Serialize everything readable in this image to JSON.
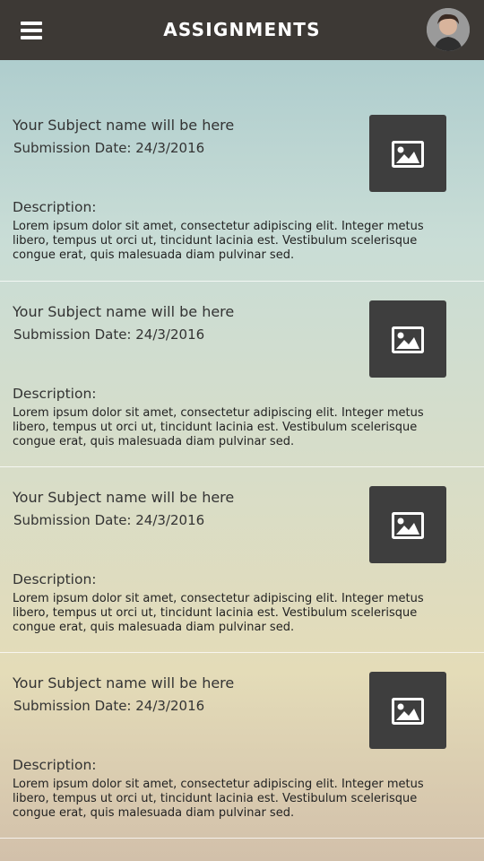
{
  "header": {
    "title": "ASSIGNMENTS",
    "menu_icon": "hamburger-menu-icon",
    "avatar_icon": "user-avatar"
  },
  "assignments": [
    {
      "subject": "Your Subject name will be here",
      "submission": "Submission Date: 24/3/2016",
      "description_label": "Description:",
      "description": "Lorem ipsum dolor sit amet, consectetur adipiscing elit. Integer metus libero, tempus ut orci ut, tincidunt lacinia est. Vestibulum scelerisque congue erat, quis malesuada diam pulvinar sed.",
      "thumb_icon": "image-placeholder-icon"
    },
    {
      "subject": "Your Subject name will be here",
      "submission": "Submission Date: 24/3/2016",
      "description_label": "Description:",
      "description": "Lorem ipsum dolor sit amet, consectetur adipiscing elit. Integer metus libero, tempus ut orci ut, tincidunt lacinia est. Vestibulum scelerisque congue erat, quis malesuada diam pulvinar sed.",
      "thumb_icon": "image-placeholder-icon"
    },
    {
      "subject": "Your Subject name will be here",
      "submission": "Submission Date: 24/3/2016",
      "description_label": "Description:",
      "description": "Lorem ipsum dolor sit amet, consectetur adipiscing elit. Integer metus libero, tempus ut orci ut, tincidunt lacinia est. Vestibulum scelerisque congue erat, quis malesuada diam pulvinar sed.",
      "thumb_icon": "image-placeholder-icon"
    },
    {
      "subject": "Your Subject name will be here",
      "submission": "Submission Date: 24/3/2016",
      "description_label": "Description:",
      "description": "Lorem ipsum dolor sit amet, consectetur adipiscing elit. Integer metus libero, tempus ut orci ut, tincidunt lacinia est. Vestibulum scelerisque congue erat, quis malesuada diam pulvinar sed.",
      "thumb_icon": "image-placeholder-icon"
    }
  ],
  "colors": {
    "header_bg": "#3d3935",
    "thumb_bg": "#3e3e3e"
  }
}
